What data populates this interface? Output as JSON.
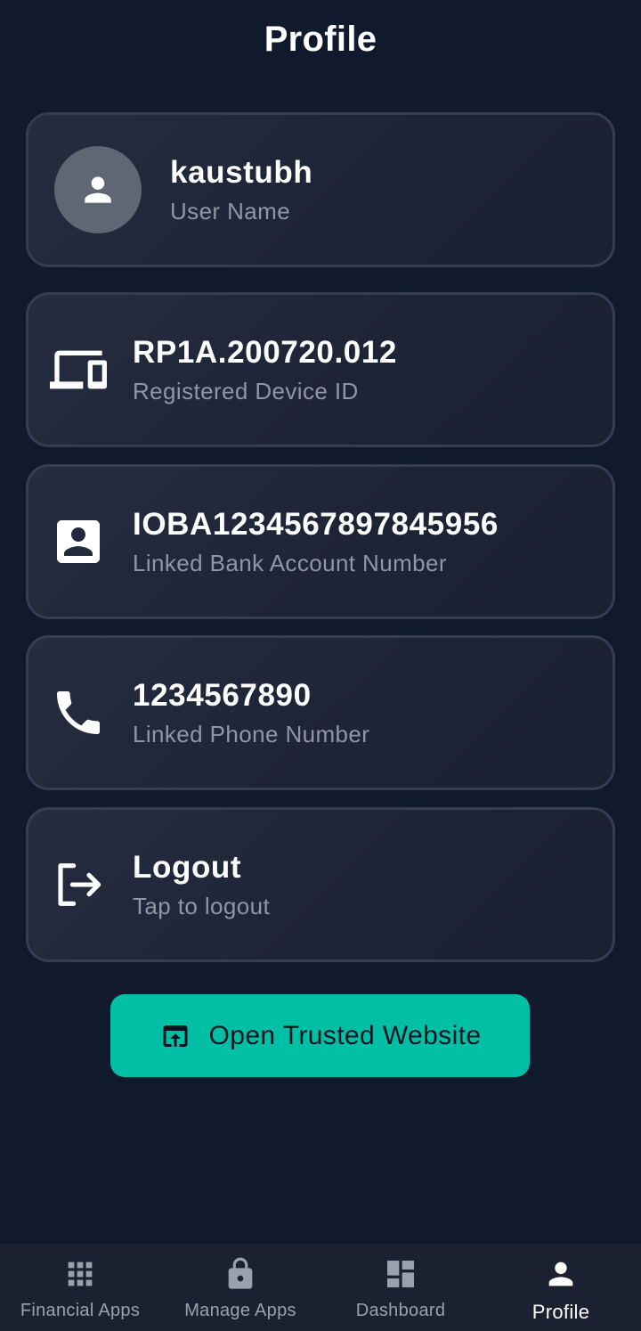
{
  "header": {
    "title": "Profile"
  },
  "profile_cards": {
    "user": {
      "primary": "kaustubh",
      "secondary": "User Name",
      "icon": "person-icon"
    },
    "device": {
      "primary": "RP1A.200720.012",
      "secondary": "Registered Device ID",
      "icon": "devices-icon"
    },
    "bank": {
      "primary": "IOBA1234567897845956",
      "secondary": "Linked Bank Account Number",
      "icon": "account-box-icon"
    },
    "phone": {
      "primary": "1234567890",
      "secondary": "Linked Phone Number",
      "icon": "phone-icon"
    },
    "logout": {
      "primary": "Logout",
      "secondary": "Tap to logout",
      "icon": "logout-icon"
    }
  },
  "cta": {
    "label": "Open Trusted Website",
    "icon": "open-in-browser-icon",
    "color": "#00bfa5"
  },
  "bottom_nav": {
    "items": [
      {
        "label": "Financial Apps",
        "icon": "apps-grid-icon",
        "active": false
      },
      {
        "label": "Manage Apps",
        "icon": "lock-icon",
        "active": false
      },
      {
        "label": "Dashboard",
        "icon": "dashboard-icon",
        "active": false
      },
      {
        "label": "Profile",
        "icon": "person-icon",
        "active": true
      }
    ]
  },
  "colors": {
    "background": "#111a2c",
    "card_border": "#353d52",
    "accent": "#00bfa5",
    "secondary_text": "#8f97a6",
    "nav_inactive": "#9aa1ad"
  }
}
